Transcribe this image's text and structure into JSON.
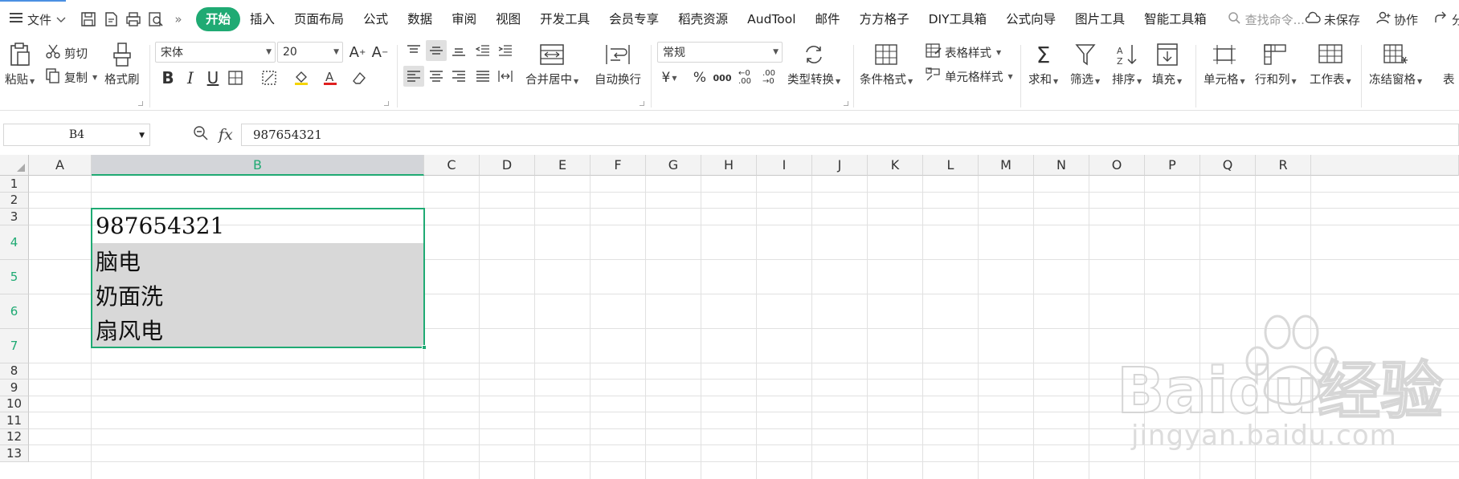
{
  "menubar": {
    "file_label": "文件",
    "tabs": [
      "开始",
      "插入",
      "页面布局",
      "公式",
      "数据",
      "审阅",
      "视图",
      "开发工具",
      "会员专享",
      "稻壳资源",
      "AudTool",
      "邮件",
      "方方格子",
      "DIY工具箱",
      "公式向导",
      "图片工具",
      "智能工具箱"
    ],
    "active_tab": "开始",
    "search_placeholder": "查找命令...",
    "unsaved_label": "未保存",
    "collab_label": "协作",
    "share_label": "分享"
  },
  "ribbon": {
    "paste": "粘贴",
    "cut": "剪切",
    "copy": "复制",
    "format_painter": "格式刷",
    "font_name": "宋体",
    "font_size": "20",
    "merge_center": "合并居中",
    "wrap_text": "自动换行",
    "number_format": "常规",
    "type_convert": "类型转换",
    "cond_format": "条件格式",
    "table_style": "表格样式",
    "cell_style": "单元格样式",
    "sum": "求和",
    "filter": "筛选",
    "sort": "排序",
    "fill": "填充",
    "cell": "单元格",
    "row_col": "行和列",
    "worksheet": "工作表",
    "freeze": "冻结窗格",
    "more": "表"
  },
  "formula_bar": {
    "name_box": "B4",
    "fx": "fx",
    "value": "987654321"
  },
  "sheet": {
    "columns": [
      "A",
      "B",
      "C",
      "D",
      "E",
      "F",
      "G",
      "H",
      "I",
      "J",
      "K",
      "L",
      "M",
      "N",
      "O",
      "P",
      "Q",
      "R"
    ],
    "rows": [
      "1",
      "2",
      "3",
      "4",
      "5",
      "6",
      "7",
      "8",
      "9",
      "10",
      "11",
      "12",
      "13"
    ],
    "selected_column": "B",
    "cells": {
      "B4": "987654321",
      "B5": "脑电",
      "B6": "奶面洗",
      "B7": "扇风电"
    }
  },
  "watermark": {
    "brand": "Baidu经验",
    "url": "jingyan.baidu.com"
  }
}
